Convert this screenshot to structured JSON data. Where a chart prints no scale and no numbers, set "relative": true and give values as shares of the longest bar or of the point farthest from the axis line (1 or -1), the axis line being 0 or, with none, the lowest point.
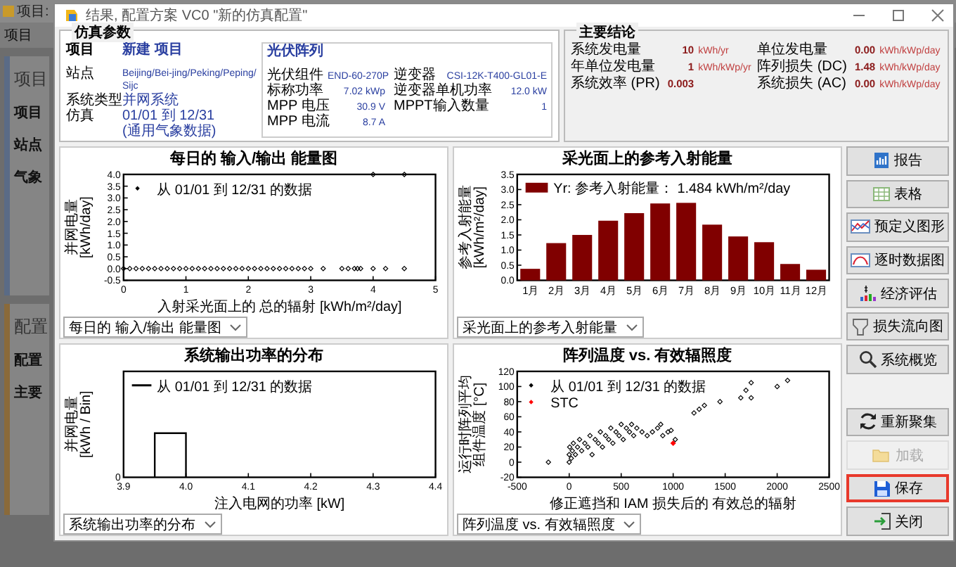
{
  "background_app": {
    "title": "项目:",
    "menu": [
      "项目"
    ],
    "panel_title": "项目",
    "rows": [
      "项目",
      "站点",
      "气象"
    ],
    "panel2_title": "配置",
    "panel2_rows": [
      "配置",
      "主要"
    ]
  },
  "window": {
    "title": "结果, 配置方案 VC0 \"新的仿真配置\""
  },
  "simulation_parameters": {
    "title": "仿真参数",
    "project": {
      "label": "项目",
      "value": "新建 项目"
    },
    "project_rows": [
      {
        "label": "站点",
        "value": "Beijing/Bei-jing/Peking/Peping/Sijc"
      },
      {
        "label": "系统类型",
        "value": "并网系统"
      },
      {
        "label": "仿真",
        "value": "01/01 到 12/31"
      },
      {
        "value": "(通用气象数据)"
      }
    ],
    "pv_array": {
      "title": "光伏阵列",
      "rows": [
        {
          "label": "光伏组件",
          "value": "END-60-270P"
        },
        {
          "label": "标称功率",
          "value": "7.02 kWp"
        },
        {
          "label": "MPP 电压",
          "value": "30.9 V"
        },
        {
          "label": "MPP 电流",
          "value": "8.7 A"
        }
      ]
    },
    "inverter": {
      "rows": [
        {
          "label": "逆变器",
          "value": "CSI-12K-T400-GL01-E"
        },
        {
          "label": "逆变器单机功率",
          "value": "12.0  kW"
        },
        {
          "label": "MPPT输入数量",
          "value": "1"
        }
      ]
    }
  },
  "main_results": {
    "title": "主要结论",
    "rows": [
      {
        "label": "系统发电量",
        "value": "10",
        "unit": "kWh/yr"
      },
      {
        "label": "单位发电量",
        "value": "0.00",
        "unit": "kWh/kWp/day"
      },
      {
        "label": "年单位发电量",
        "value": "1",
        "unit": "kWh/kWp/yr"
      },
      {
        "label": "阵列损失 (DC)",
        "value": "1.48",
        "unit": "kWh/kWp/day"
      },
      {
        "label": "系统效率 (PR)",
        "value": "0.003"
      },
      {
        "label": "系统损失 (AC)",
        "value": "0.00",
        "unit": "kWh/kWp/day"
      }
    ]
  },
  "charts": [
    {
      "title": "每日的 输入/输出 能量图",
      "dropdown": "每日的 输入/输出 能量图",
      "chart_data": {
        "type": "scatter",
        "legend": "upper left",
        "xlabel": "入射采光面上的 总的辐射 [kWh/m²/day]",
        "ylabel": "并网电量 [kWh/day]",
        "xlim": [
          0,
          5
        ],
        "ylim": [
          -0.5,
          4.0
        ],
        "xticks": [
          0,
          1,
          2,
          3,
          4,
          5
        ],
        "yticks": [
          {
            "value": -0.5,
            "label": "-0.5"
          },
          {
            "value": 0,
            "label": "0.0"
          },
          {
            "value": 0.5,
            "label": "0.5"
          },
          {
            "value": 1,
            "label": "1.0"
          },
          {
            "value": 1.5,
            "label": "1.5"
          },
          {
            "value": 2,
            "label": "2.0"
          },
          {
            "value": 2.5,
            "label": "2.5"
          },
          {
            "value": 3,
            "label": "3.0"
          },
          {
            "value": 3.5,
            "label": "3.5"
          },
          {
            "value": 4,
            "label": "4.0"
          }
        ],
        "x": [
          0,
          0.1,
          0.2,
          0.3,
          0.4,
          0.5,
          0.6,
          0.7,
          0.8,
          0.9,
          1,
          1.1,
          1.2,
          1.3,
          1.4,
          1.5,
          1.6,
          1.7,
          1.8,
          1.9,
          2,
          2.1,
          2.2,
          2.3,
          2.4,
          2.5,
          2.6,
          2.7,
          2.8,
          2.9,
          3.0,
          3.2,
          3.5,
          3.6,
          3.7,
          3.75,
          3.8,
          4.0,
          4.2,
          4.5,
          4.0,
          4.5
        ],
        "series": [
          {
            "name": "从 01/01 到 12/31 的数据",
            "color": "#000000",
            "values": [
              0,
              0,
              0,
              0,
              0,
              0,
              0,
              0,
              0,
              0,
              0,
              0,
              0,
              0,
              0,
              0,
              0,
              0,
              0,
              0,
              0,
              0,
              0,
              0,
              0,
              0,
              0,
              0,
              0,
              0,
              0,
              0,
              0,
              0,
              0,
              0,
              0,
              0,
              0,
              0,
              4.0,
              4.0
            ]
          }
        ]
      }
    },
    {
      "title": "采光面上的参考入射能量",
      "dropdown": "采光面上的参考入射能量",
      "chart_data": {
        "type": "bar",
        "legend": "upper left",
        "ylabel": "参考入射能量 [kWh/m²/day]",
        "categories": [
          "1月",
          "2月",
          "3月",
          "4月",
          "5月",
          "6月",
          "7月",
          "8月",
          "9月",
          "10月",
          "11月",
          "12月"
        ],
        "ylim": [
          0,
          3.5
        ],
        "yticks": [
          {
            "value": 0,
            "label": "0.0"
          },
          0.5,
          {
            "value": 1,
            "label": "1.0"
          },
          1.5,
          {
            "value": 2,
            "label": "2.0"
          },
          2.5,
          {
            "value": 3,
            "label": "3.0"
          },
          3.5
        ],
        "series": [
          {
            "name": "Yr: 参考入射能量： 1.484 kWh/m²/day",
            "color": "#800000",
            "values": [
              0.38,
              1.23,
              1.5,
              1.97,
              2.22,
              2.54,
              2.56,
              1.84,
              1.45,
              1.26,
              0.54,
              0.35
            ]
          }
        ]
      }
    },
    {
      "title": "系统输出功率的分布",
      "dropdown": "系统输出功率的分布",
      "chart_data": {
        "type": "line",
        "legend": "upper left",
        "relative": true,
        "xlabel": "注入电网的功率 [kW]",
        "ylabel": "并网电量 [kWh / Bin]",
        "x": [
          3.95,
          3.95,
          4.0,
          4.0
        ],
        "xlim": [
          3.9,
          4.4
        ],
        "xticks": [
          3.9,
          {
            "value": 4,
            "label": "4.0"
          },
          4.1,
          4.2,
          4.3,
          4.4
        ],
        "annotations": [
          {
            "text": "0"
          }
        ],
        "series": [
          {
            "name": "从 01/01 到 12/31 的数据",
            "color": "#000000",
            "values": [
              0,
              1,
              1,
              0
            ]
          }
        ]
      }
    },
    {
      "title": "阵列温度 vs. 有效辐照度",
      "dropdown": "阵列温度 vs. 有效辐照度",
      "chart_data": {
        "type": "scatter",
        "legend": "upper left",
        "xlabel": "修正遮挡和 IAM 损失后的 有效总的辐射",
        "ylabel": "运行时阵列平均组件温度 [°C]",
        "xlim": [
          -500,
          2500
        ],
        "ylim": [
          -20,
          120
        ],
        "xticks": [
          -500,
          0,
          500,
          1000,
          1500,
          2000,
          2500
        ],
        "yticks": [
          -20,
          0,
          20,
          40,
          60,
          80,
          100,
          120
        ],
        "x": [
          0,
          0,
          5,
          20,
          30,
          40,
          60,
          80,
          100,
          120,
          150,
          180,
          200,
          220,
          250,
          280,
          300,
          320,
          350,
          380,
          400,
          420,
          450,
          480,
          500,
          520,
          550,
          580,
          600,
          620,
          650,
          700,
          750,
          800,
          850,
          900,
          950,
          -200,
          1200,
          1250,
          1300,
          1450,
          1650,
          1700,
          1750,
          1750,
          2000,
          2100,
          1020,
          880,
          980,
          1000
        ],
        "series": [
          {
            "name": "从 01/01 到 12/31 的数据",
            "color": "#000000",
            "values": [
              0,
              10,
              20,
              5,
              15,
              25,
              10,
              20,
              30,
              15,
              25,
              20,
              35,
              10,
              30,
              25,
              40,
              20,
              35,
              30,
              45,
              25,
              40,
              35,
              50,
              30,
              45,
              40,
              50,
              35,
              45,
              40,
              35,
              40,
              45,
              35,
              40,
              0,
              65,
              70,
              75,
              80,
              85,
              95,
              105,
              85,
              100,
              108,
              30,
              50,
              42,
              null
            ]
          },
          {
            "name": "STC",
            "color": "#ff0000",
            "values": [
              null,
              null,
              null,
              null,
              null,
              null,
              null,
              null,
              null,
              null,
              null,
              null,
              null,
              null,
              null,
              null,
              null,
              null,
              null,
              null,
              null,
              null,
              null,
              null,
              null,
              null,
              null,
              null,
              null,
              null,
              null,
              null,
              null,
              null,
              null,
              null,
              null,
              null,
              null,
              null,
              null,
              null,
              null,
              null,
              null,
              null,
              null,
              null,
              null,
              null,
              null,
              25
            ]
          }
        ]
      }
    }
  ],
  "buttons_top": [
    {
      "label": "报告",
      "kind": "report",
      "disabled": false,
      "highlighted": false
    },
    {
      "label": "表格",
      "kind": "table",
      "disabled": false,
      "highlighted": false
    },
    {
      "label": "预定义图形",
      "kind": "graph",
      "disabled": false,
      "highlighted": false
    },
    {
      "label": "逐时数据图",
      "kind": "hourly",
      "disabled": false,
      "highlighted": false
    },
    {
      "label": "经济评估",
      "kind": "economy",
      "disabled": false,
      "highlighted": false
    },
    {
      "label": "损失流向图",
      "kind": "loss",
      "disabled": false,
      "highlighted": false
    },
    {
      "label": "系统概览",
      "kind": "overview",
      "disabled": false,
      "highlighted": false
    }
  ],
  "buttons_bottom": [
    {
      "label": "重新聚集",
      "kind": "reload",
      "disabled": false,
      "highlighted": false
    },
    {
      "label": "加载",
      "kind": "load",
      "disabled": true,
      "highlighted": false
    },
    {
      "label": "保存",
      "kind": "save",
      "disabled": false,
      "highlighted": true
    },
    {
      "label": "关闭",
      "kind": "close",
      "disabled": false,
      "highlighted": false
    }
  ]
}
